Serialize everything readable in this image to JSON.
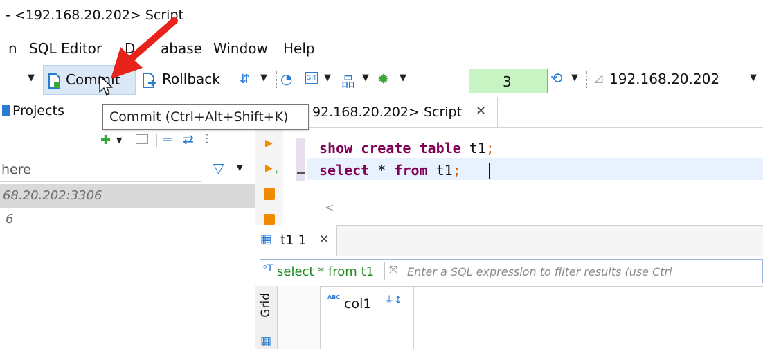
{
  "title_bar": {
    "title": "- <192.168.20.202> Script"
  },
  "menu": {
    "items": [
      "n",
      "SQL Editor",
      "D",
      "abase",
      "Window",
      "Help"
    ]
  },
  "toolbar": {
    "commit_label": "Commit",
    "rollback_label": "Rollback",
    "result_limit": "3",
    "connection": "192.168.20.202"
  },
  "tooltip": {
    "text": "Commit (Ctrl+Alt+Shift+K)"
  },
  "left_panel": {
    "tab_label": "Projects",
    "filter_text": "here",
    "connection_row": "68.20.202:3306",
    "database_row": "6"
  },
  "editor": {
    "tab_label": "92.168.20.202> Script",
    "lines": [
      {
        "keywords": "show create table",
        "rest": " t1",
        "end": ";"
      },
      {
        "kw1": "select",
        "star": " * ",
        "kw2": "from",
        "rest": " t1",
        "end": ";"
      }
    ],
    "scroll_left": "<"
  },
  "results": {
    "tab_label": "t1 1",
    "query_text": "select * from t1",
    "filter_placeholder": "Enter a SQL expression to filter results (use Ctrl",
    "grid_tab": "Grid",
    "column_type": "ABC",
    "column_name": "col1"
  },
  "colors": {
    "commit_highlight": "#dbe9f7",
    "limit_field": "#c8f4c4",
    "keyword": "#7f0055",
    "semicolon": "#d15a00",
    "current_line": "#e8f2fe",
    "arrow_annotation": "#e8231c"
  }
}
